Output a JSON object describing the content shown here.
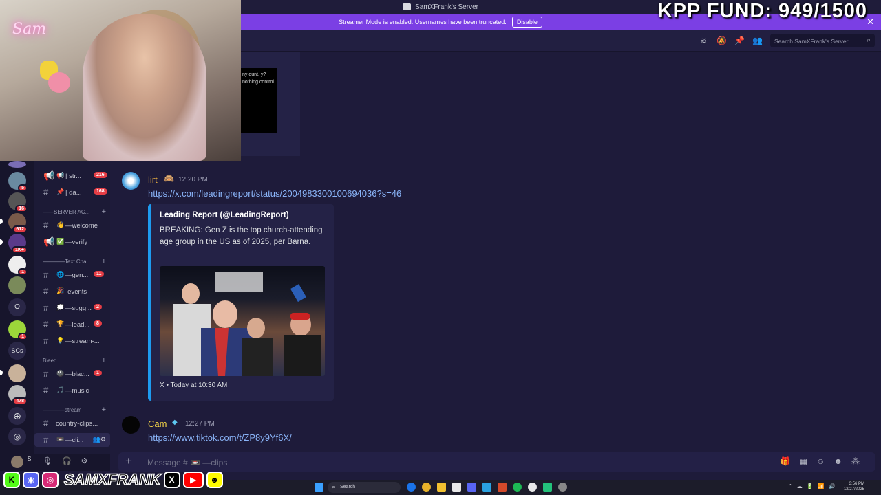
{
  "window": {
    "title": "SamXFrank's Server"
  },
  "banner": {
    "text": "Streamer Mode is enabled. Usernames have been truncated.",
    "disable_label": "Disable",
    "close_glyph": "✕"
  },
  "overlay": {
    "fund_text": "KPP FUND: 949/1500",
    "neon_sign": "Sam",
    "handle": "SAMXFRANK"
  },
  "toolbar": {
    "search_placeholder": "Search SamXFrank's Server"
  },
  "rail": {
    "badges": [
      "5",
      "16",
      "612",
      "1K+",
      "1",
      "1",
      "478"
    ],
    "text_servers": [
      "O",
      "SCs"
    ]
  },
  "channels": {
    "items": [
      {
        "emoji": "📢",
        "name": "| str...",
        "count": "216"
      },
      {
        "emoji": "📌",
        "name": "| da...",
        "count": "168"
      },
      {
        "emoji": "👋",
        "name": "—welcome",
        "count": ""
      },
      {
        "emoji": "✅",
        "name": "—verify",
        "count": ""
      },
      {
        "emoji": "🌐",
        "name": "—gen...",
        "count": "11"
      },
      {
        "emoji": "🎉",
        "name": "·events",
        "count": ""
      },
      {
        "emoji": "💭",
        "name": "—sugg...",
        "count": "2"
      },
      {
        "emoji": "🏆",
        "name": "—lead...",
        "count": "8"
      },
      {
        "emoji": "💡",
        "name": "—stream-...",
        "count": ""
      },
      {
        "emoji": "🎱",
        "name": "—blac...",
        "count": "1"
      },
      {
        "emoji": "🎵",
        "name": "—music",
        "count": ""
      },
      {
        "emoji": "",
        "name": "country-clips...",
        "count": ""
      },
      {
        "emoji": "📼",
        "name": "—cli...",
        "count": ""
      }
    ],
    "categories": {
      "server": "——SERVER AC...",
      "text": "————Text Cha...",
      "bleed": "Bleed",
      "stream": "————stream"
    }
  },
  "user": {
    "name": "S",
    "sub": "..."
  },
  "chat": {
    "prev_embed_text": "ny ount, y? nothing control",
    "messages": [
      {
        "author": "lirt",
        "time": "12:20 PM",
        "link": "https://x.com/leadingreport/status/2004983300100694036?s=46",
        "embed": {
          "title": "Leading Report (@LeadingReport)",
          "description": "BREAKING: Gen Z is the top church-attending age group in the US as of 2025, per Barna.",
          "footer": "X • Today at 10:30 AM"
        }
      },
      {
        "author": "Cam",
        "time": "12:27 PM",
        "link": "https://www.tiktok.com/t/ZP8y9Yf6X/"
      }
    ]
  },
  "composer": {
    "placeholder": "Message # 📼 —clips"
  },
  "taskbar": {
    "search_label": "Search",
    "time": "3:56 PM",
    "date": "12/27/2025"
  },
  "colors": {
    "accent": "#7b3fe4",
    "link": "#8ab4f8",
    "author_lirt": "#d9a441",
    "author_cam": "#f5d547",
    "mention_red": "#e53d45"
  }
}
